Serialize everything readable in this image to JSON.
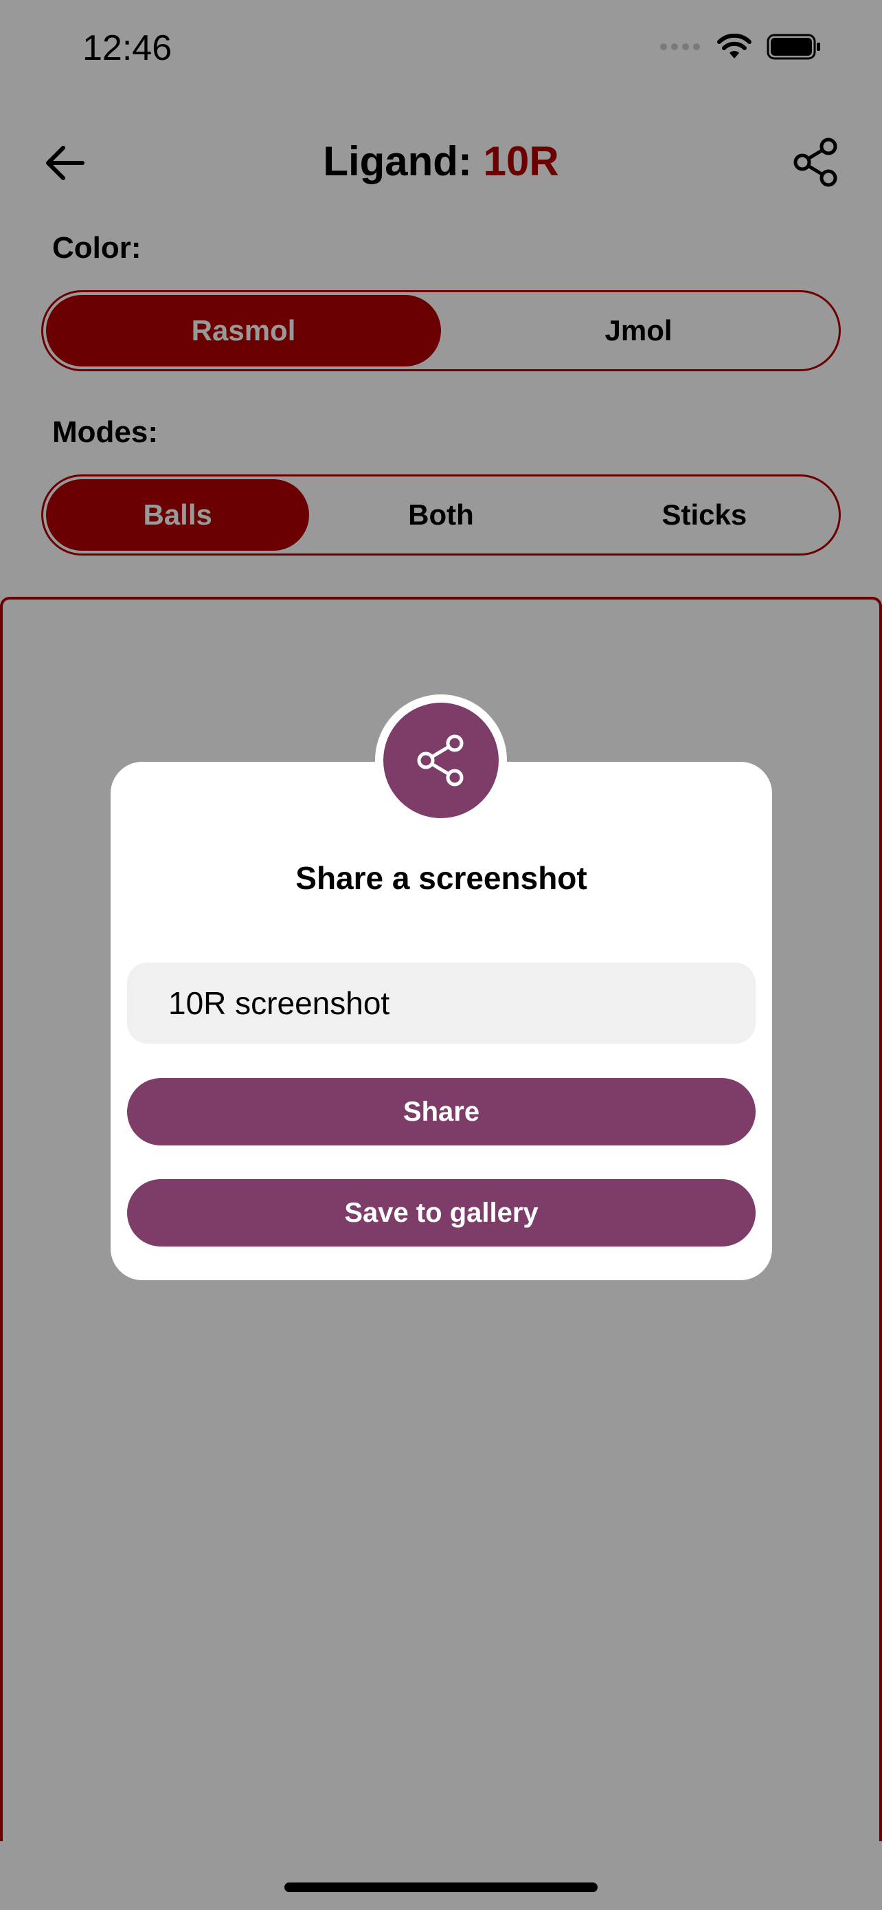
{
  "status_bar": {
    "time": "12:46"
  },
  "header": {
    "title_prefix": "Ligand: ",
    "title_accent": "10R",
    "accent_color": "#6b0000"
  },
  "color_section": {
    "label": "Color:",
    "options": [
      "Rasmol",
      "Jmol"
    ],
    "selected": "Rasmol"
  },
  "modes_section": {
    "label": "Modes:",
    "options": [
      "Balls",
      "Both",
      "Sticks"
    ],
    "selected": "Balls"
  },
  "modal": {
    "title": "Share a screenshot",
    "input_value": "10R screenshot",
    "share_label": "Share",
    "save_label": "Save to gallery",
    "button_color": "#7e3d69"
  }
}
